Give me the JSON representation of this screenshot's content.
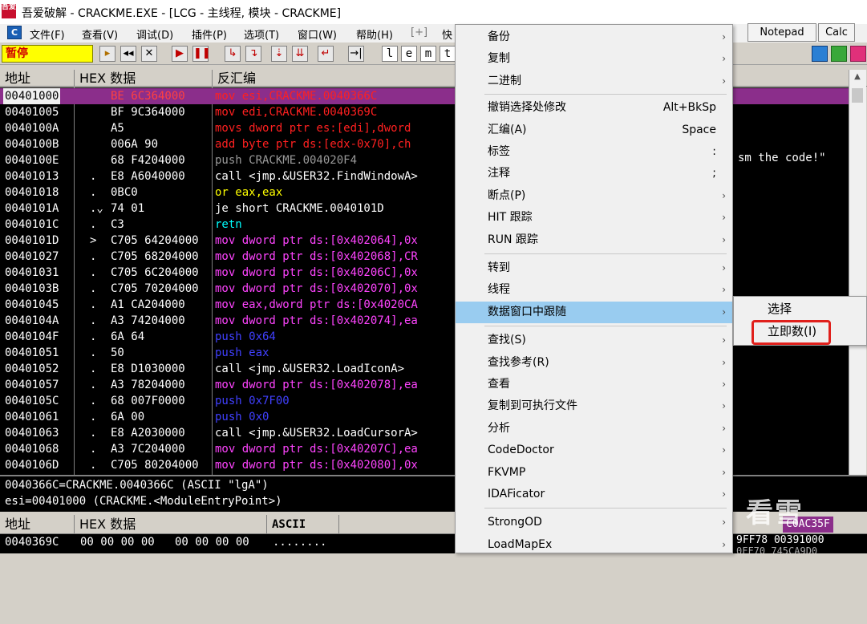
{
  "window": {
    "title": "吾爱破解 - CRACKME.EXE - [LCG - 主线程, 模块 - CRACKME]",
    "icon_text": "吾爱"
  },
  "menubar": {
    "logo": "C",
    "items": [
      "文件(F)",
      "查看(V)",
      "调试(D)",
      "插件(P)",
      "选项(T)",
      "窗口(W)",
      "帮助(H)",
      "[+]",
      "快"
    ],
    "right_buttons": [
      "Notepad",
      "Calc"
    ]
  },
  "toolbar": {
    "status": "暂停",
    "buttons": [
      "▸",
      "◂◂",
      "✕",
      "▶",
      "❚❚",
      "↳",
      "↴",
      "⇣",
      "⇊",
      "↵",
      "→|"
    ],
    "letters": [
      "l",
      "e",
      "m",
      "t"
    ]
  },
  "cpu": {
    "headers": {
      "address": "地址",
      "hex": "HEX 数据",
      "disasm": "反汇编"
    },
    "comment_fragment": "sm the code!\"",
    "rows": [
      {
        "addr": "00401000",
        "flag": "",
        "hex": "BE 6C364000",
        "asm": "mov esi,CRACKME.0040366C",
        "color": "#ff2020",
        "selected": true
      },
      {
        "addr": "00401005",
        "flag": "",
        "hex": "BF 9C364000",
        "asm": "mov edi,CRACKME.0040369C",
        "color": "#ff2020"
      },
      {
        "addr": "0040100A",
        "flag": "",
        "hex": "A5",
        "asm": "movs dword ptr es:[edi],dword",
        "color": "#ff2020"
      },
      {
        "addr": "0040100B",
        "flag": "",
        "hex": "006A 90",
        "asm": "add byte ptr ds:[edx-0x70],ch",
        "color": "#ff2020"
      },
      {
        "addr": "0040100E",
        "flag": "",
        "hex": "68 F4204000",
        "asm": "push CRACKME.004020F4",
        "color": "#9a9a9a"
      },
      {
        "addr": "00401013",
        "flag": ".",
        "hex": "E8 A6040000",
        "asm": "call <jmp.&USER32.FindWindowA>",
        "color": "#ffffff"
      },
      {
        "addr": "00401018",
        "flag": ".",
        "hex": "0BC0",
        "asm": "or eax,eax",
        "color": "#ffff00"
      },
      {
        "addr": "0040101A",
        "flag": ".⌄",
        "hex": "74 01",
        "asm": "je short CRACKME.0040101D",
        "color": "#ffffff"
      },
      {
        "addr": "0040101C",
        "flag": ".",
        "hex": "C3",
        "asm": "retn",
        "color": "#00ffff"
      },
      {
        "addr": "0040101D",
        "flag": ">",
        "hex": "C705 64204000",
        "asm": "mov dword ptr ds:[0x402064],0x",
        "color": "#ff44ff"
      },
      {
        "addr": "00401027",
        "flag": ".",
        "hex": "C705 68204000",
        "asm": "mov dword ptr ds:[0x402068],CR",
        "color": "#ff44ff"
      },
      {
        "addr": "00401031",
        "flag": ".",
        "hex": "C705 6C204000",
        "asm": "mov dword ptr ds:[0x40206C],0x",
        "color": "#ff44ff"
      },
      {
        "addr": "0040103B",
        "flag": ".",
        "hex": "C705 70204000",
        "asm": "mov dword ptr ds:[0x402070],0x",
        "color": "#ff44ff"
      },
      {
        "addr": "00401045",
        "flag": ".",
        "hex": "A1 CA204000",
        "asm": "mov eax,dword ptr ds:[0x4020CA",
        "color": "#ff44ff"
      },
      {
        "addr": "0040104A",
        "flag": ".",
        "hex": "A3 74204000",
        "asm": "mov dword ptr ds:[0x402074],ea",
        "color": "#ff44ff"
      },
      {
        "addr": "0040104F",
        "flag": ".",
        "hex": "6A 64",
        "asm": "push 0x64",
        "color": "#4040ff"
      },
      {
        "addr": "00401051",
        "flag": ".",
        "hex": "50",
        "asm": "push eax",
        "color": "#4040ff"
      },
      {
        "addr": "00401052",
        "flag": ".",
        "hex": "E8 D1030000",
        "asm": "call <jmp.&USER32.LoadIconA>",
        "color": "#ffffff"
      },
      {
        "addr": "00401057",
        "flag": ".",
        "hex": "A3 78204000",
        "asm": "mov dword ptr ds:[0x402078],ea",
        "color": "#ff44ff"
      },
      {
        "addr": "0040105C",
        "flag": ".",
        "hex": "68 007F0000",
        "asm": "push 0x7F00",
        "color": "#4040ff"
      },
      {
        "addr": "00401061",
        "flag": ".",
        "hex": "6A 00",
        "asm": "push 0x0",
        "color": "#4040ff"
      },
      {
        "addr": "00401063",
        "flag": ".",
        "hex": "E8 A2030000",
        "asm": "call <jmp.&USER32.LoadCursorA>",
        "color": "#ffffff"
      },
      {
        "addr": "00401068",
        "flag": ".",
        "hex": "A3 7C204000",
        "asm": "mov dword ptr ds:[0x40207C],ea",
        "color": "#ff44ff"
      },
      {
        "addr": "0040106D",
        "flag": ".",
        "hex": "C705 80204000",
        "asm": "mov dword ptr ds:[0x402080],0x",
        "color": "#ff44ff"
      }
    ]
  },
  "info": {
    "line1": "0040366C=CRACKME.0040366C (ASCII \"lgA\")",
    "line2": "esi=00401000 (CRACKME.<ModuleEntryPoint>)"
  },
  "dump": {
    "headers": {
      "address": "地址",
      "hex": "HEX 数据",
      "ascii": "ASCII"
    },
    "row": {
      "addr": "0040369C",
      "hex1": "00 00 00 00",
      "hex2": "00 00 00 00",
      "ascii": "........"
    },
    "right_fragment1": "9FF78 00391000",
    "right_fragment2": "0FF70 745CA9D0",
    "right_header_fragment": "C0AC35F"
  },
  "context_menu": {
    "items": [
      {
        "label": "备份",
        "shortcut": "",
        "arrow": true
      },
      {
        "label": "复制",
        "shortcut": "",
        "arrow": true
      },
      {
        "label": "二进制",
        "shortcut": "",
        "arrow": true
      },
      {
        "label": "撤销选择处修改",
        "shortcut": "Alt+BkSp",
        "arrow": false
      },
      {
        "label": "汇编(A)",
        "shortcut": "Space",
        "arrow": false
      },
      {
        "label": "标签",
        "shortcut": ":",
        "arrow": false
      },
      {
        "label": "注释",
        "shortcut": ";",
        "arrow": false
      },
      {
        "label": "断点(P)",
        "shortcut": "",
        "arrow": true
      },
      {
        "label": "HIT 跟踪",
        "shortcut": "",
        "arrow": true
      },
      {
        "label": "RUN 跟踪",
        "shortcut": "",
        "arrow": true
      },
      {
        "label": "转到",
        "shortcut": "",
        "arrow": true
      },
      {
        "label": "线程",
        "shortcut": "",
        "arrow": true
      },
      {
        "label": "数据窗口中跟随",
        "shortcut": "",
        "arrow": true,
        "highlighted": true
      },
      {
        "label": "查找(S)",
        "shortcut": "",
        "arrow": true
      },
      {
        "label": "查找参考(R)",
        "shortcut": "",
        "arrow": true
      },
      {
        "label": "查看",
        "shortcut": "",
        "arrow": true
      },
      {
        "label": "复制到可执行文件",
        "shortcut": "",
        "arrow": true
      },
      {
        "label": "分析",
        "shortcut": "",
        "arrow": true
      },
      {
        "label": "CodeDoctor",
        "shortcut": "",
        "arrow": true
      },
      {
        "label": "FKVMP",
        "shortcut": "",
        "arrow": true
      },
      {
        "label": "IDAFicator",
        "shortcut": "",
        "arrow": true
      },
      {
        "label": "StrongOD",
        "shortcut": "",
        "arrow": true
      },
      {
        "label": "LoadMapEx",
        "shortcut": "",
        "arrow": true
      }
    ]
  },
  "submenu": {
    "items": [
      "选择",
      "立即数(I)"
    ]
  },
  "watermark": "看雪"
}
